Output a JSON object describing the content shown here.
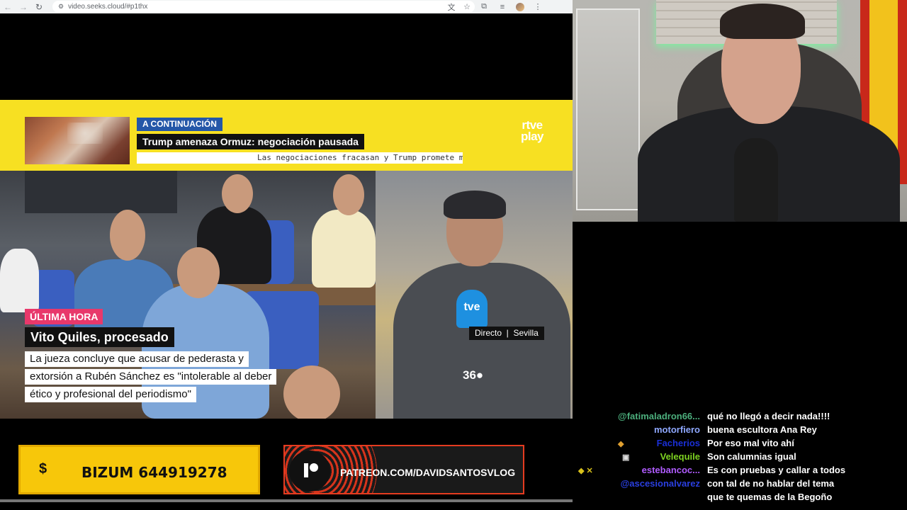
{
  "browser": {
    "url": "video.seeks.cloud/#p1thx",
    "back_icon": "arrow-left-icon",
    "forward_icon": "arrow-right-icon",
    "reload_icon": "reload-icon"
  },
  "broadcast": {
    "next_tag": "A CONTINUACIÓN",
    "next_title": "Trump amenaza Ormuz: negociación pausada",
    "next_subtitle": "Las negociaciones fracasan y Trump promete ma",
    "channel_logo": "rtve\nplay",
    "breaking_tag": "ÚLTIMA HORA",
    "headline": "Vito Quiles, procesado",
    "body_lines": [
      "La jueza concluye que acusar de pederasta y",
      "extorsión a Rubén Sánchez es \"intolerable al deber",
      "ético y profesional del periodismo\""
    ],
    "location": "Directo  |  Sevilla",
    "mic_label": "tve",
    "logo_360": "36●"
  },
  "donations": {
    "bizum_symbol": "$",
    "bizum_label": "BIZUM 644919278",
    "patreon_label": "PATREON.COM/DAVIDSANTOSVLOG"
  },
  "chat": {
    "messages": [
      {
        "user": "@fatimaladron66...",
        "color": "#4caf7d",
        "badges": "",
        "text": "qué no llegó a decir nada!!!!"
      },
      {
        "user": "motorfiero",
        "color": "#8fa8ff",
        "badges": "",
        "text": "buena escultora Ana Rey"
      },
      {
        "user": "Facherios",
        "color": "#1a2fd6",
        "badges": "◆",
        "text": "Por eso mal vito ahí"
      },
      {
        "user": "Velequile",
        "color": "#7ed321",
        "badges": "▣",
        "text": "Son calumnias igual"
      },
      {
        "user": "estebancoc...",
        "color": "#b05cff",
        "badges": "◆ ✕",
        "text": "Es con pruebas y callar a todos"
      },
      {
        "user": "@ascesionalvarez",
        "color": "#2a3fe0",
        "badges": "",
        "text": "con tal de no hablar del tema"
      },
      {
        "user": "",
        "color": "#ffffff",
        "badges": "",
        "text": "que te quemas de la Begoño"
      }
    ]
  }
}
